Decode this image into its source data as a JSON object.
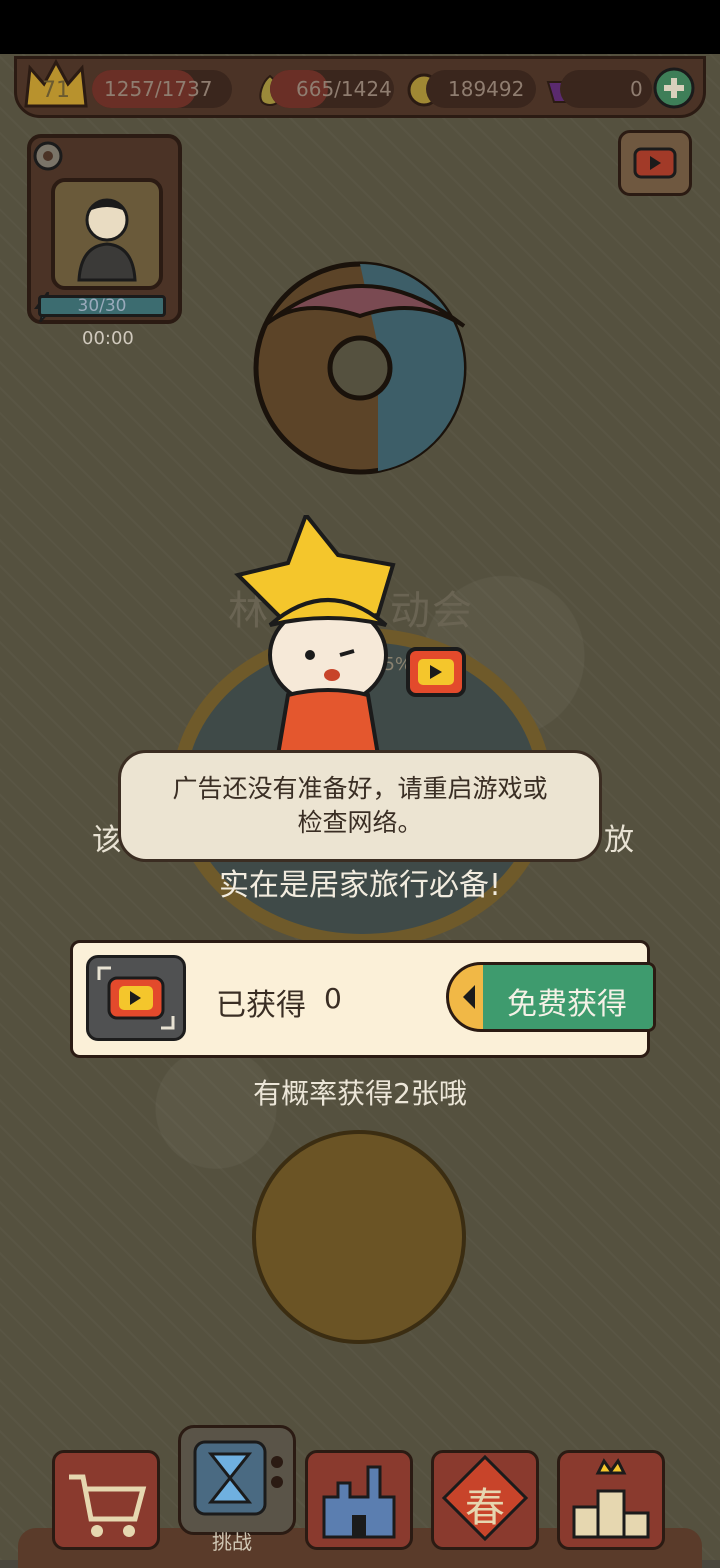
{
  "resources": {
    "level": "71",
    "experience": "1257/1737",
    "food": "665/1424",
    "coins": "189492",
    "gems": "0"
  },
  "profile": {
    "energy": "30/30",
    "timer": "00:00"
  },
  "event": {
    "title_partial_left": "林",
    "title_partial_right": "动会",
    "progress_partial": "95%",
    "desc_left_char": "该",
    "desc_right_char": "放",
    "desc_line2": "实在是居家旅行必备!"
  },
  "toast": {
    "message": "广告还没有准备好，请重启游戏或检查网络。"
  },
  "reward": {
    "obtained_label": "已获得",
    "obtained_count": "0",
    "free_button": "免费获得",
    "chance_text": "有概率获得2张哦"
  },
  "bottom_nav": {
    "challenge_label": "挑战",
    "spring_glyph": "春"
  },
  "colors": {
    "accent_green": "#3e9b6e",
    "accent_orange": "#f1b846",
    "panel_cream": "#fbf0d8",
    "video_red": "#e34a2c"
  },
  "icons": [
    "gear-icon",
    "crown-icon",
    "pear-icon",
    "coin-icon",
    "gem-icon",
    "plus-icon",
    "video-icon",
    "lightning-icon",
    "cart-icon",
    "tv-icon",
    "castle-icon",
    "spring-icon",
    "podium-icon"
  ]
}
